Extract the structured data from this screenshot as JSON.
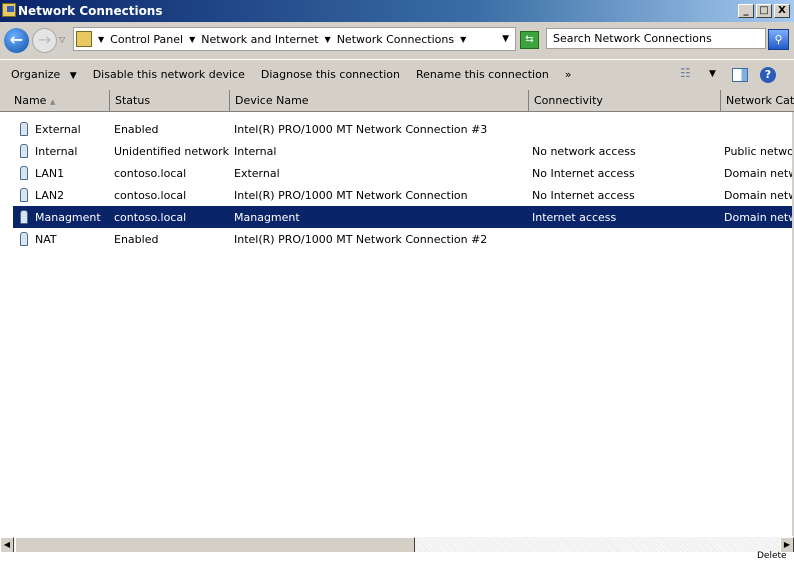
{
  "window": {
    "title": "Network Connections",
    "minimize": "_",
    "maximize": "□",
    "close": "X"
  },
  "nav": {
    "breadcrumbs": [
      "Control Panel",
      "Network and Internet",
      "Network Connections"
    ],
    "search_placeholder": "Search Network Connections"
  },
  "toolbar": {
    "organize": "Organize",
    "disable": "Disable this network device",
    "diagnose": "Diagnose this connection",
    "rename": "Rename this connection",
    "more": "»"
  },
  "columns": [
    "Name",
    "Status",
    "Device Name",
    "Connectivity",
    "Network Cate"
  ],
  "rows": [
    {
      "name": "External",
      "status": "Enabled",
      "device": "Intel(R) PRO/1000 MT Network Connection #3",
      "connectivity": "",
      "category": ""
    },
    {
      "name": "Internal",
      "status": "Unidentified network",
      "device": "Internal",
      "connectivity": "No network access",
      "category": "Public network"
    },
    {
      "name": "LAN1",
      "status": "contoso.local",
      "device": "External",
      "connectivity": "No Internet access",
      "category": "Domain network"
    },
    {
      "name": "LAN2",
      "status": "contoso.local",
      "device": "Intel(R) PRO/1000 MT Network Connection",
      "connectivity": "No Internet access",
      "category": "Domain network"
    },
    {
      "name": "Managment",
      "status": "contoso.local",
      "device": "Managment",
      "connectivity": "Internet access",
      "category": "Domain network",
      "selected": true
    },
    {
      "name": "NAT",
      "status": "Enabled",
      "device": "Intel(R) PRO/1000 MT Network Connection #2",
      "connectivity": "",
      "category": ""
    }
  ],
  "background_window": {
    "label": "Delete"
  },
  "colors": {
    "selection": "#0a246a",
    "title_gradient_start": "#0a246a"
  }
}
